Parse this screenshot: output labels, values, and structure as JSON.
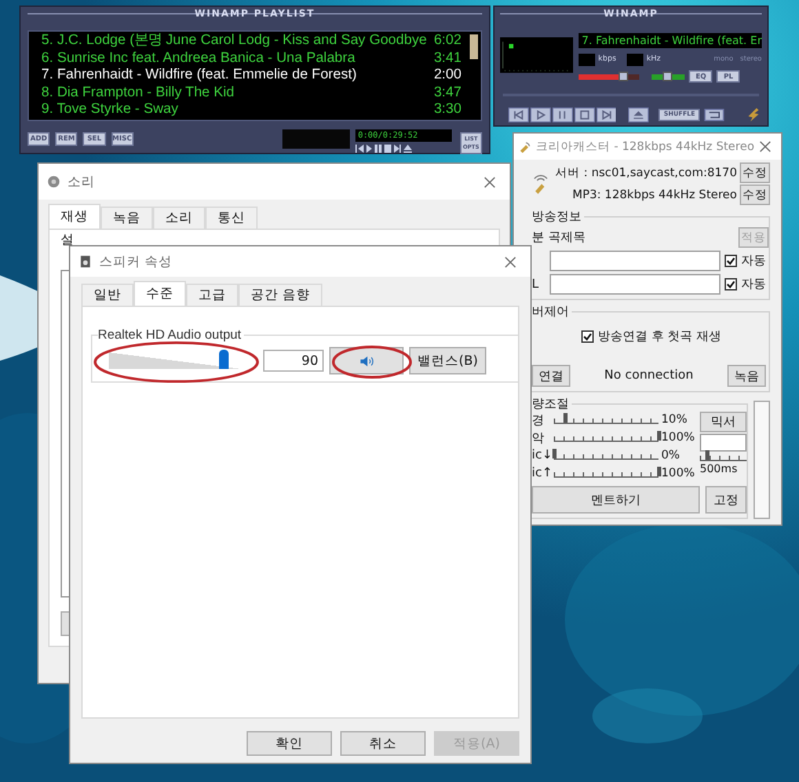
{
  "playlist": {
    "title": "WINAMP PLAYLIST",
    "tracks": [
      {
        "title": "5. J.C. Lodge (본명 June Carol Lodg - Kiss and Say Goodbye",
        "time": "6:02",
        "selected": false
      },
      {
        "title": "6. Sunrise Inc feat. Andreea Banica - Una Palabra",
        "time": "3:41",
        "selected": false
      },
      {
        "title": "7. Fahrenhaidt - Wildfire (feat. Emmelie de Forest)",
        "time": "2:00",
        "selected": true
      },
      {
        "title": "8. Dia Frampton - Billy The Kid",
        "time": "3:47",
        "selected": false
      },
      {
        "title": "9. Tove Styrke - Sway",
        "time": "3:30",
        "selected": false
      }
    ],
    "buttons": [
      "ADD",
      "REM",
      "SEL",
      "MISC"
    ],
    "time": "0:00/0:29:52",
    "list_opts": "LIST OPTS"
  },
  "player": {
    "title": "WINAMP",
    "song": "7. Fahrenhaidt - Wildfire (feat. Er",
    "units": [
      "kbps",
      "kHz"
    ],
    "modes": [
      "mono",
      "stereo"
    ],
    "volume": {
      "level": 0.75
    },
    "balance": {
      "level": 0.5
    },
    "toggles": [
      "EQ",
      "PL"
    ],
    "shuffle": "SHUFFLE"
  },
  "caster": {
    "title": "크리아캐스터 - 128kbps 44kHz Stereo",
    "server": "서버 : nsc01,saycast,com:8170",
    "format": "MP3: 128kbps 44kHz Stereo",
    "edit_buttons": [
      "수정",
      "수정"
    ],
    "info": {
      "label": "방송정보",
      "column_label": "분  곡제목",
      "apply": {
        "label": "적용",
        "disabled": true
      },
      "rows": [
        {
          "auto_label": "자동",
          "checked": true
        },
        {
          "label": "L",
          "auto_label": "자동",
          "checked": true
        }
      ]
    },
    "control": {
      "label": "버제어",
      "autoplay": {
        "label": "방송연결 후 첫곡 재생",
        "checked": true
      },
      "connect": "연결",
      "status": "No connection",
      "record": "녹음"
    },
    "volume": {
      "label": "량조절",
      "rows": [
        {
          "label": "경",
          "level": 0.1,
          "reading": "10%"
        },
        {
          "label": "악",
          "level": 1,
          "reading": "100%"
        },
        {
          "label": "ic↓",
          "level": 0,
          "reading": "0%"
        },
        {
          "label": "ic↑",
          "level": 1,
          "reading": "100%"
        }
      ],
      "mixer": "믹서",
      "delay": {
        "label": "500ms",
        "level": 0.15
      },
      "talk": "멘트하기",
      "fix": "고정"
    }
  },
  "sound": {
    "title": "소리",
    "tabs": [
      {
        "label": "재생",
        "selected": true
      },
      {
        "label": "녹음",
        "selected": false
      },
      {
        "label": "소리",
        "selected": false
      },
      {
        "label": "통신",
        "selected": false
      }
    ],
    "text": "설"
  },
  "speaker": {
    "title": "스피커 속성",
    "tabs": [
      {
        "label": "일반",
        "selected": false
      },
      {
        "label": "수준",
        "selected": true
      },
      {
        "label": "고급",
        "selected": false
      },
      {
        "label": "공간 음향",
        "selected": false
      }
    ],
    "group": "Realtek HD Audio output",
    "volume": {
      "level": 0.88,
      "value": "90"
    },
    "balance": "밸런스(B)",
    "buttons": [
      {
        "label": "확인",
        "disabled": false
      },
      {
        "label": "취소",
        "disabled": false
      },
      {
        "label": "적용(A)",
        "disabled": true
      }
    ]
  }
}
